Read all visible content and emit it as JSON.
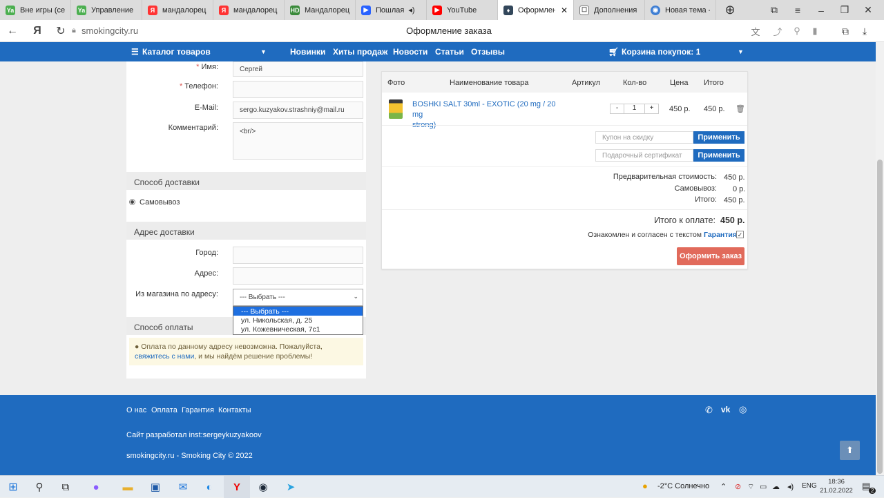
{
  "browser": {
    "tabs": [
      {
        "label": "Вне игры (сер",
        "favicon": "Ya"
      },
      {
        "label": "Управление N",
        "favicon": "Ya"
      },
      {
        "label": "мандалорец т",
        "favicon": "Я"
      },
      {
        "label": "мандалорец с",
        "favicon": "Я"
      },
      {
        "label": "Мандалорец",
        "favicon": "HD"
      },
      {
        "label": "Пошлая",
        "favicon": "▶"
      },
      {
        "label": "YouTube",
        "favicon": "▶"
      },
      {
        "label": "Оформлен",
        "favicon": "♦",
        "active": true
      },
      {
        "label": "Дополнения",
        "favicon": "☐"
      },
      {
        "label": "Новая тема -",
        "favicon": "◉"
      }
    ],
    "url": "smokingcity.ru",
    "page_title": "Оформление заказа"
  },
  "site_nav": {
    "catalog": "Каталог товаров",
    "links": [
      "Новинки",
      "Хиты продаж",
      "Новости",
      "Статьи",
      "Отзывы"
    ],
    "cart": "Корзина покупок: 1"
  },
  "form": {
    "name_label": "Имя:",
    "name_value": "Сергей",
    "phone_label": "Телефон:",
    "phone_value": "",
    "email_label": "E-Mail:",
    "email_value": "sergo.kuzyakov.strashniy@mail.ru",
    "comment_label": "Комментарий:",
    "comment_value": "<br/>",
    "required_mark": "*"
  },
  "delivery": {
    "heading": "Способ доставки",
    "option": "Самовывоз"
  },
  "address": {
    "heading": "Адрес доставки",
    "city_label": "Город:",
    "addr_label": "Адрес:",
    "store_label": "Из магазина по адресу:",
    "select_value": "--- Выбрать ---",
    "options": [
      "--- Выбрать ---",
      "ул. Никольская, д. 25",
      "ул. Кожевническая, 7с1"
    ]
  },
  "payment": {
    "heading": "Способ оплаты",
    "alert_text": "Оплата по данному адресу невозможна. Пожалуйста,",
    "alert_link": "свяжитесь с нами",
    "alert_tail": ", и мы найдём решение проблемы!"
  },
  "cart": {
    "headers": [
      "Фото",
      "Наименование товара",
      "Артикул",
      "Кол-во",
      "Цена",
      "Итого"
    ],
    "item_name_1": "BOSHKI SALT 30ml - EXOTIC (20 mg / 20 mg",
    "item_name_2": "strong)",
    "qty": "1",
    "minus": "-",
    "plus": "+",
    "price": "450 р.",
    "total": "450 р.",
    "coupon_placeholder": "Купон на скидку",
    "gift_placeholder": "Подарочный сертификат",
    "apply": "Применить",
    "pre_cost_label": "Предварительная стоимость:",
    "pre_cost_value": "450 р.",
    "pickup_label": "Самовывоз:",
    "pickup_value": "0 р.",
    "subtotal_label": "Итого:",
    "subtotal_value": "450 р.",
    "pay_total_label": "Итого к оплате:",
    "pay_total_value": "450 р.",
    "agree_text": "Ознакомлен и согласен с текстом",
    "agree_link": "Гарантия",
    "order_button": "Оформить заказ"
  },
  "footer": {
    "links": [
      "О нас",
      "Оплата",
      "Гарантия",
      "Контакты"
    ],
    "dev": "Сайт разработал inst:sergeykuzyakoov",
    "copyright": "smokingcity.ru - Smoking City © 2022"
  },
  "taskbar": {
    "weather": "-2°C  Солнечно",
    "lang": "ENG",
    "time": "18:36",
    "date": "21.02.2022",
    "notif_count": "2"
  },
  "colors": {
    "brand": "#1f6bbf",
    "order_button": "#e16a5b",
    "selected": "#1e6fe0"
  }
}
